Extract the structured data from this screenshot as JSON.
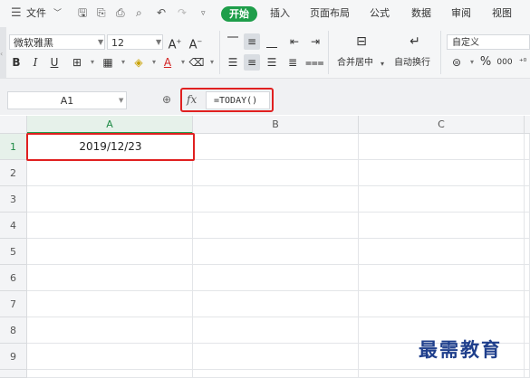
{
  "menu": {
    "hamburger_label": "文件",
    "tabs": [
      "开始",
      "插入",
      "页面布局",
      "公式",
      "数据",
      "审阅",
      "视图"
    ],
    "active_tab": "开始"
  },
  "ribbon": {
    "font_name": "微软雅黑",
    "font_size": "12",
    "merge_center": "合并居中",
    "auto_wrap": "自动换行",
    "number_format": "自定义"
  },
  "formula_bar": {
    "name_box": "A1",
    "fx_label": "fx",
    "formula": "=TODAY()"
  },
  "sheet": {
    "columns": [
      "A",
      "B",
      "C"
    ],
    "rows": [
      "1",
      "2",
      "3",
      "4",
      "5",
      "6",
      "7",
      "8",
      "9"
    ],
    "active_cell_value": "2019/12/23"
  },
  "watermark": "最需教育",
  "colors": {
    "accent_green": "#1e9e4a",
    "highlight_red": "#e02020"
  }
}
